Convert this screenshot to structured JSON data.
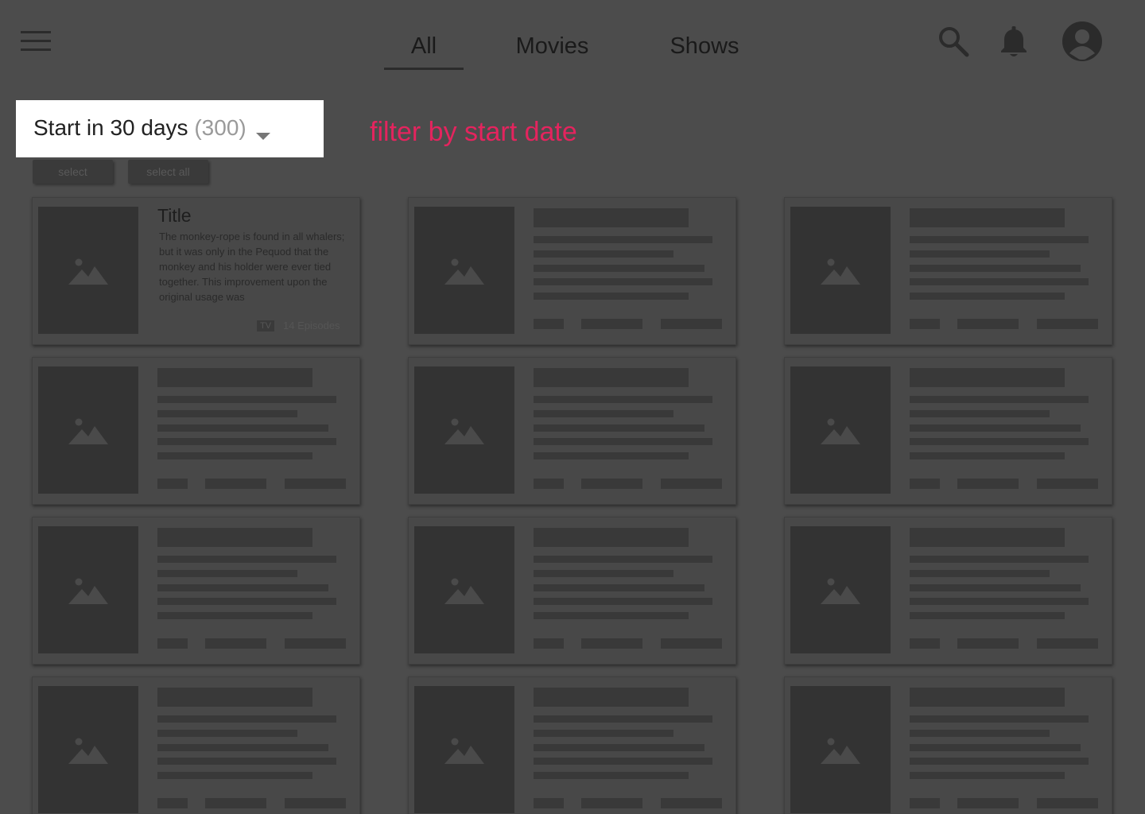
{
  "header": {
    "tabs": [
      {
        "label": "All",
        "active": true
      },
      {
        "label": "Movies",
        "active": false
      },
      {
        "label": "Shows",
        "active": false
      }
    ],
    "icons": [
      "hamburger-menu-icon",
      "search-icon",
      "bell-icon",
      "avatar-icon"
    ]
  },
  "filter": {
    "label": "Start in 30 days",
    "count": "(300)"
  },
  "annotation": "filter by start date",
  "actions": {
    "select_label": "select",
    "select_all_label": "select all"
  },
  "first_card": {
    "title": "Title",
    "description": "The monkey-rope is found in all whalers; but it was only in the Pequod that the monkey and his holder were ever tied together. This improvement upon the original usage was",
    "badge": "TV",
    "episodes": "14 Episodes"
  },
  "colors": {
    "background": "#4c4c4c",
    "annotation": "#e4245e",
    "filter_bg": "#ffffff"
  }
}
